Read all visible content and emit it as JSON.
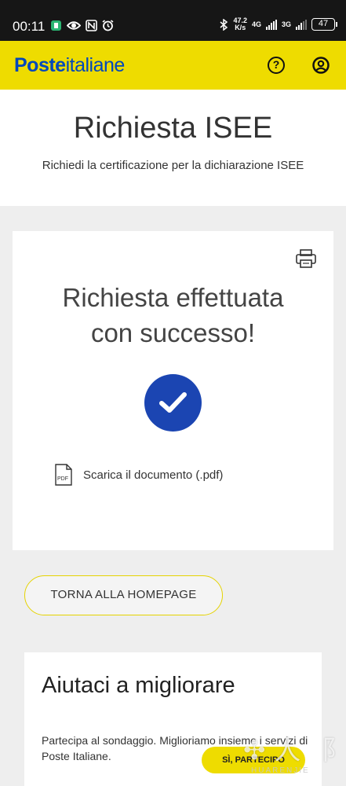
{
  "status_bar": {
    "time": "00:11",
    "speed_value": "47.2",
    "speed_unit": "K/s",
    "network_1": "4G",
    "network_2": "3G",
    "battery": "47"
  },
  "app_bar": {
    "logo_bold": "Poste",
    "logo_regular": "italiane",
    "help_glyph": "?",
    "help_icon": "question-circle-icon",
    "profile_icon": "user-circle-icon",
    "brand_color": "#eedc00",
    "logo_color": "#0047bb"
  },
  "header": {
    "title": "Richiesta ISEE",
    "subtitle": "Richiedi la certificazione per la dichiarazione ISEE"
  },
  "result_card": {
    "print_icon": "printer-icon",
    "title_line1": "Richiesta effettuata",
    "title_line2": "con successo!",
    "success_icon": "check-circle-icon",
    "success_color": "#1b45b2",
    "download_icon": "pdf-file-icon",
    "download_label": "Scarica il documento (.pdf)"
  },
  "home_button_label": "TORNA ALLA HOMEPAGE",
  "survey": {
    "title": "Aiutaci a migliorare",
    "text": "Partecipa al sondaggio. Miglioriamo insieme i servizi di Poste Italiane.",
    "button_label": "SÌ, PARTECIPO"
  },
  "watermark": {
    "text": "HUARENJIE"
  }
}
